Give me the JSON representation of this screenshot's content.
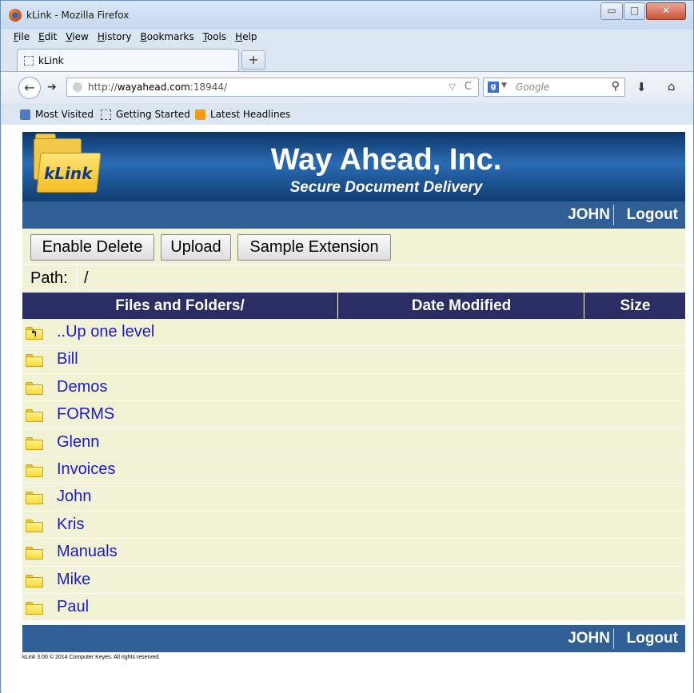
{
  "window": {
    "title": "kLink - Mozilla Firefox",
    "minimize": "▭",
    "maximize": "□",
    "close": "✕"
  },
  "menu": [
    "File",
    "Edit",
    "View",
    "History",
    "Bookmarks",
    "Tools",
    "Help"
  ],
  "tabs": [
    {
      "label": "kLink"
    }
  ],
  "new_tab": "+",
  "address": {
    "prefix": "http://",
    "host": "wayahead.com",
    "port": ":18944/"
  },
  "search": {
    "engine": "g",
    "placeholder": "Google"
  },
  "bookmarks": [
    "Most Visited",
    "Getting Started",
    "Latest Headlines"
  ],
  "header": {
    "logo_text": "kLink",
    "company": "Way Ahead, Inc.",
    "tagline": "Secure Document Delivery"
  },
  "user": {
    "name": "JOHN",
    "logout": "Logout"
  },
  "toolbar": {
    "enable_delete": "Enable Delete",
    "upload": "Upload",
    "sample_extension": "Sample Extension"
  },
  "path": {
    "label": "Path:",
    "value": "/"
  },
  "table": {
    "columns": [
      "Files and Folders/",
      "Date Modified",
      "Size"
    ],
    "rows": [
      {
        "name": "..Up one level",
        "icon": "folder-up-icon"
      },
      {
        "name": "Bill",
        "icon": "folder-icon"
      },
      {
        "name": "Demos",
        "icon": "folder-icon"
      },
      {
        "name": "FORMS",
        "icon": "folder-icon"
      },
      {
        "name": "Glenn",
        "icon": "folder-icon"
      },
      {
        "name": "Invoices",
        "icon": "folder-icon"
      },
      {
        "name": "John",
        "icon": "folder-icon"
      },
      {
        "name": "Kris",
        "icon": "folder-icon"
      },
      {
        "name": "Manuals",
        "icon": "folder-icon"
      },
      {
        "name": "Mike",
        "icon": "folder-icon"
      },
      {
        "name": "Paul",
        "icon": "folder-icon"
      }
    ]
  },
  "footer": "kLink 3.00 © 2014 Computer Keyes. All rights reserved.",
  "colors": {
    "header_dark": "#0c3566",
    "userbar": "#2f5f95",
    "table_header": "#2b2e62",
    "row_bg": "#f2f2d6",
    "link": "#1a1acc"
  }
}
